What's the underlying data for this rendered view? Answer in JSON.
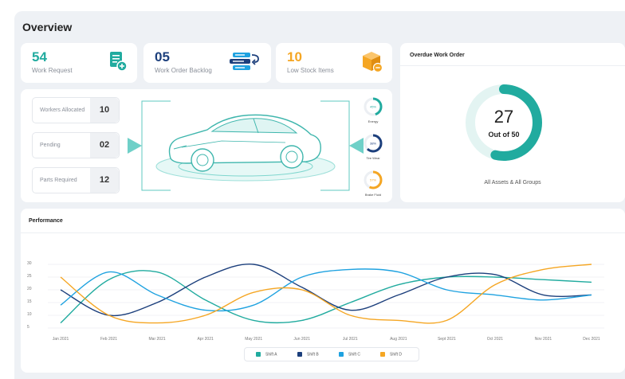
{
  "page_title": "Overview",
  "stats": [
    {
      "value": "54",
      "label": "Work Request",
      "color": "#21ab9f",
      "icon": "add-document-icon"
    },
    {
      "value": "05",
      "label": "Work Order Backlog",
      "color": "#1c3f7c",
      "icon": "list-backlog-icon"
    },
    {
      "value": "10",
      "label": "Low Stock Items",
      "color": "#f5a623",
      "icon": "box-icon"
    }
  ],
  "overdue": {
    "title": "Overdue Work Order",
    "value": "27",
    "out_of": "Out of 50",
    "fraction": 0.54,
    "subtitle": "All Assets & All Groups",
    "color": "#21ab9f"
  },
  "vehicle": {
    "stats": [
      {
        "label": "Workers Allocated",
        "value": "10"
      },
      {
        "label": "Pending",
        "value": "02"
      },
      {
        "label": "Parts Required",
        "value": "12"
      }
    ],
    "gauges": [
      {
        "percent": "45%",
        "label": "Energy",
        "fraction": 0.45,
        "color": "#21ab9f"
      },
      {
        "percent": "38%",
        "label": "Tire Wear",
        "fraction": 0.62,
        "color": "#1c3f7c"
      },
      {
        "percent": "57%",
        "label": "Brake Fluid",
        "fraction": 0.57,
        "color": "#f5a623"
      }
    ]
  },
  "performance": {
    "title": "Performance"
  },
  "chart_data": {
    "type": "line",
    "categories": [
      "Jan 2021",
      "Feb 2021",
      "Mar 2021",
      "Apr 2021",
      "May 2021",
      "Jun 2021",
      "Jul 2021",
      "Aug 2021",
      "Sept 2021",
      "Oct 2021",
      "Nov 2021",
      "Dec 2021"
    ],
    "ylim": [
      5,
      30
    ],
    "yticks": [
      "30",
      "25",
      "20",
      "15",
      "10",
      "5"
    ],
    "grid": true,
    "legend": "bottom",
    "series": [
      {
        "name": "Shift A",
        "color": "#21ab9f",
        "values": [
          7,
          24,
          27,
          16,
          8,
          8,
          15,
          22,
          25,
          25,
          24,
          23
        ]
      },
      {
        "name": "Shift B",
        "color": "#1c3f7c",
        "values": [
          20,
          10,
          15,
          25,
          30,
          21,
          12,
          18,
          25,
          26,
          18,
          18
        ]
      },
      {
        "name": "Shift C",
        "color": "#1fa2e0",
        "values": [
          14,
          27,
          18,
          12,
          14,
          25,
          28,
          27,
          20,
          18,
          16,
          18
        ]
      },
      {
        "name": "Shift D",
        "color": "#f5a623",
        "values": [
          25,
          10,
          7,
          10,
          19,
          20,
          10,
          8,
          8,
          22,
          28,
          30
        ]
      }
    ]
  }
}
